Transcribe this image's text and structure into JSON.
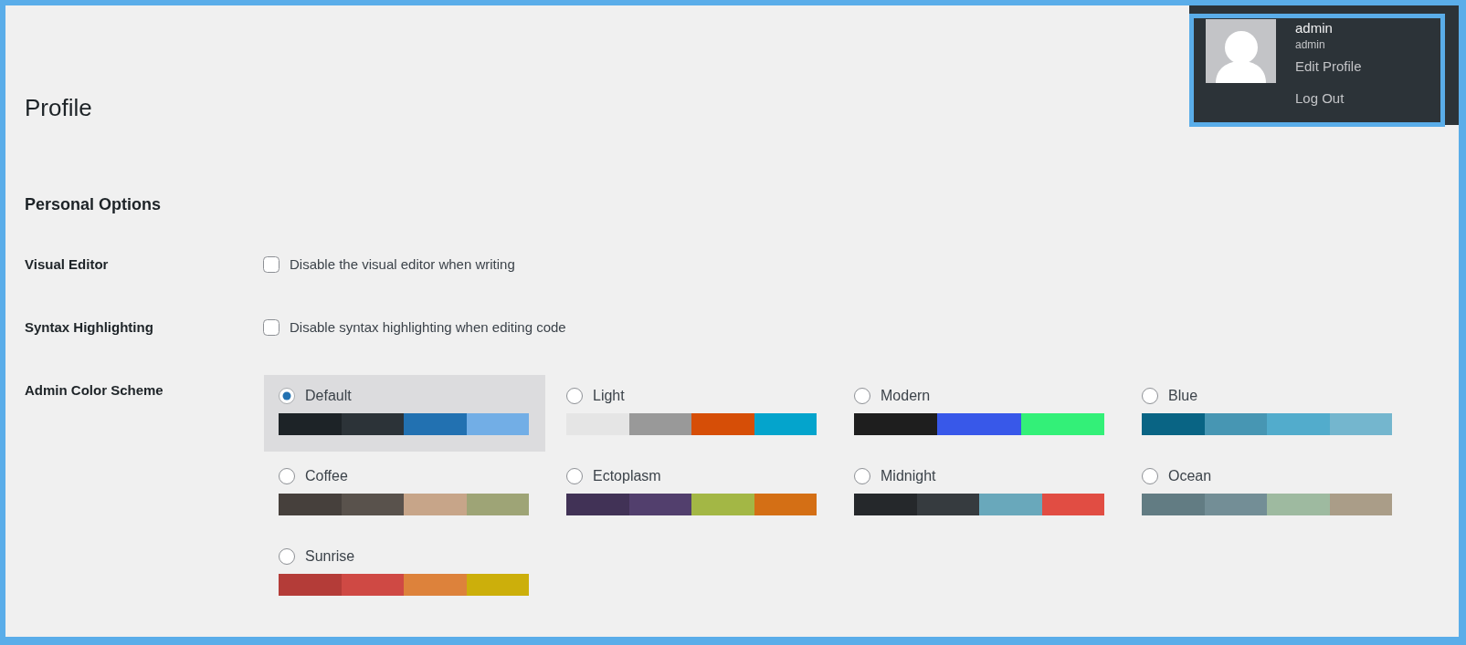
{
  "account_menu": {
    "display_name": "admin",
    "username": "admin",
    "links": [
      "Edit Profile",
      "Log Out"
    ]
  },
  "page": {
    "title": "Profile",
    "section_title": "Personal Options"
  },
  "options": [
    {
      "label": "Visual Editor",
      "text": "Disable the visual editor when writing",
      "checked": false
    },
    {
      "label": "Syntax Highlighting",
      "text": "Disable syntax highlighting when editing code",
      "checked": false
    }
  ],
  "color_scheme": {
    "label": "Admin Color Scheme",
    "schemes": [
      {
        "name": "Default",
        "selected": true,
        "swatches": [
          {
            "color": "#1d2327"
          },
          {
            "color": "#2c3338"
          },
          {
            "color": "#2271b1"
          },
          {
            "color": "#72aee6"
          }
        ]
      },
      {
        "name": "Light",
        "selected": false,
        "swatches": [
          {
            "color": "#e5e5e5"
          },
          {
            "color": "#999999"
          },
          {
            "color": "#d64e07"
          },
          {
            "color": "#04a4cc"
          }
        ]
      },
      {
        "name": "Modern",
        "selected": false,
        "swatches": [
          {
            "color": "#1e1e1e"
          },
          {
            "color": "#3858e9"
          },
          {
            "color": "#33f078"
          }
        ]
      },
      {
        "name": "Blue",
        "selected": false,
        "swatches": [
          {
            "color": "#096484"
          },
          {
            "color": "#4796b3"
          },
          {
            "color": "#52accc"
          },
          {
            "color": "#74b6ce"
          }
        ]
      },
      {
        "name": "Coffee",
        "selected": false,
        "swatches": [
          {
            "color": "#46403c"
          },
          {
            "color": "#59524c"
          },
          {
            "color": "#c7a589"
          },
          {
            "color": "#9ea476"
          }
        ]
      },
      {
        "name": "Ectoplasm",
        "selected": false,
        "swatches": [
          {
            "color": "#413256"
          },
          {
            "color": "#523f6d"
          },
          {
            "color": "#a3b745"
          },
          {
            "color": "#d46f15"
          }
        ]
      },
      {
        "name": "Midnight",
        "selected": false,
        "swatches": [
          {
            "color": "#25282b"
          },
          {
            "color": "#363b3f"
          },
          {
            "color": "#69a8bb"
          },
          {
            "color": "#e14d43"
          }
        ]
      },
      {
        "name": "Ocean",
        "selected": false,
        "swatches": [
          {
            "color": "#627c83"
          },
          {
            "color": "#738e96"
          },
          {
            "color": "#9ebaa0"
          },
          {
            "color": "#aa9d88"
          }
        ]
      },
      {
        "name": "Sunrise",
        "selected": false,
        "swatches": [
          {
            "color": "#b43c38"
          },
          {
            "color": "#cf4944"
          },
          {
            "color": "#dd823b"
          },
          {
            "color": "#ccaf0b"
          }
        ]
      }
    ]
  }
}
